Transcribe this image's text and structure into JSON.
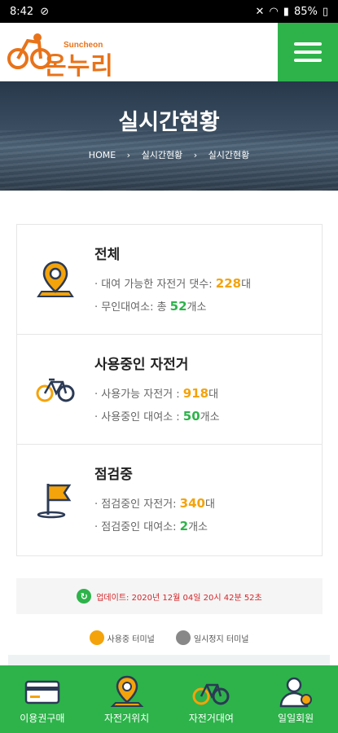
{
  "status": {
    "time": "8:42",
    "battery": "85%"
  },
  "header": {
    "logo_sub": "Suncheon",
    "logo_main": "온누리"
  },
  "hero": {
    "title": "실시간현황",
    "breadcrumb": [
      "HOME",
      "실시간현황",
      "실시간현황"
    ]
  },
  "sections": [
    {
      "title": "전체",
      "line1_label": "대여 가능한 자전거 댓수: ",
      "line1_value": "228",
      "line1_unit": "대",
      "line2_label": "무인대여소: 총 ",
      "line2_value": "52",
      "line2_unit": "개소"
    },
    {
      "title": "사용중인 자전거",
      "line1_label": "사용가능 자전거 : ",
      "line1_value": "918",
      "line1_unit": "대",
      "line2_label": "사용중인 대여소 : ",
      "line2_value": "50",
      "line2_unit": "개소"
    },
    {
      "title": "점검중",
      "line1_label": "점검중인 자전거: ",
      "line1_value": "340",
      "line1_unit": "대",
      "line2_label": "점검중인 대여소: ",
      "line2_value": "2",
      "line2_unit": "개소"
    }
  ],
  "update": {
    "text": "업데이트: 2020년 12월 04일 20시 42분 52초"
  },
  "legend": [
    {
      "label": "사용중 터미널",
      "color": "#f4a30a"
    },
    {
      "label": "일시정지 터미널",
      "color": "#888888"
    }
  ],
  "nav": [
    {
      "label": "이용권구매",
      "icon": "card-icon"
    },
    {
      "label": "자전거위치",
      "icon": "location-pin-icon"
    },
    {
      "label": "자전거대여",
      "icon": "bicycle-icon"
    },
    {
      "label": "일일회원",
      "icon": "user-icon"
    }
  ],
  "colors": {
    "brand_green": "#2db34a",
    "brand_orange": "#e8731a",
    "value_orange": "#f4a30a",
    "update_red": "#d4262a"
  }
}
